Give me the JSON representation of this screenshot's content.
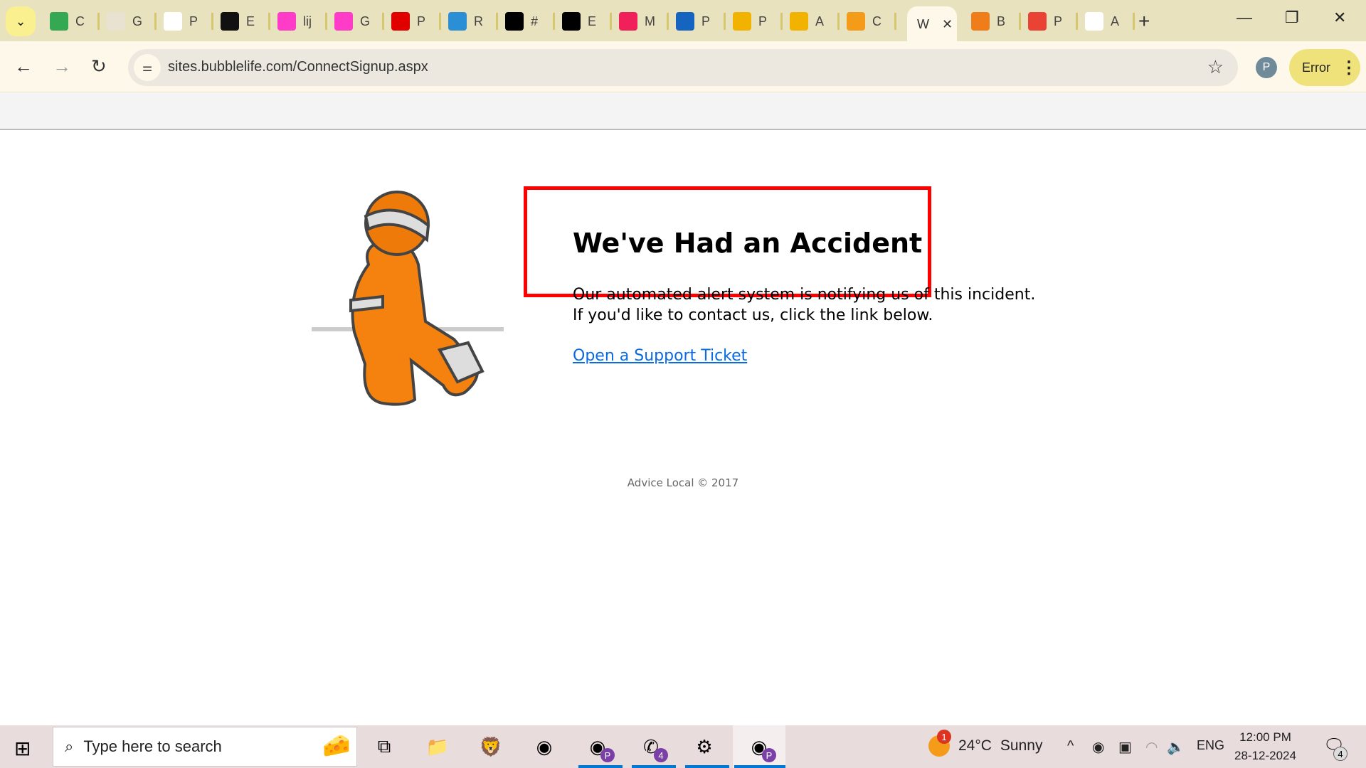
{
  "browser": {
    "tabs": [
      {
        "label": "C",
        "icon": "google-sheets-icon",
        "color": "#34a853"
      },
      {
        "label": "G",
        "icon": "goodreads-icon",
        "color": "#e9e2d0"
      },
      {
        "label": "P",
        "icon": "diamond-logo-icon",
        "color": "#ffffff"
      },
      {
        "label": "E",
        "icon": "document-logo-icon",
        "color": "#111111"
      },
      {
        "label": "lij",
        "icon": "stairs-logo-icon",
        "color": "#ff3cc7"
      },
      {
        "label": "G",
        "icon": "stairs-logo-icon",
        "color": "#ff3cc7"
      },
      {
        "label": "P",
        "icon": "f-logo-icon",
        "color": "#e00000"
      },
      {
        "label": "R",
        "icon": "circle-logo-icon",
        "color": "#2b8fd6"
      },
      {
        "label": "#",
        "icon": "cart-icon",
        "color": "#000000"
      },
      {
        "label": "E",
        "icon": "cart-icon",
        "color": "#000000"
      },
      {
        "label": "M",
        "icon": "link-icon",
        "color": "#f0205a"
      },
      {
        "label": "P",
        "icon": "di-logo-icon",
        "color": "#1565c0"
      },
      {
        "label": "P",
        "icon": "ring-logo-icon",
        "color": "#f2b300"
      },
      {
        "label": "A",
        "icon": "ring-logo-icon",
        "color": "#f2b300"
      },
      {
        "label": "C",
        "icon": "chat-logo-icon",
        "color": "#f59b1a"
      }
    ],
    "active_tab": {
      "label": "W",
      "close": "✕"
    },
    "tabs_after": [
      {
        "label": "B",
        "icon": "bf-logo-icon",
        "color": "#ef7d1a"
      },
      {
        "label": "P",
        "icon": "gmail-icon",
        "color": "#ea4335"
      },
      {
        "label": "A",
        "icon": "house-logo-icon",
        "color": "#ffffff"
      }
    ],
    "new_tab": "+",
    "window": {
      "minimize": "—",
      "restore": "❐",
      "close": "✕"
    },
    "nav": {
      "back": "←",
      "forward": "→",
      "reload": "↻"
    },
    "url": "sites.bubblelife.com/ConnectSignup.aspx",
    "profile_initial": "P",
    "error_label": "Error",
    "menu": "⋮",
    "star": "☆",
    "tab_search": "⌄"
  },
  "page": {
    "title": "We've Had an Accident",
    "message": "Our automated alert system is notifying us of this incident. If you'd like to contact us, click the link below.",
    "link": "Open a Support Ticket",
    "footer": "Advice Local © 2017",
    "annotation_color": "#ff0000",
    "link_color": "#0a6be0"
  },
  "taskbar": {
    "search_placeholder": "Type here to search",
    "apps": [
      {
        "name": "task-view",
        "glyph": "⧉"
      },
      {
        "name": "file-explorer",
        "glyph": "📁"
      },
      {
        "name": "brave",
        "glyph": "🦁"
      },
      {
        "name": "chrome",
        "glyph": "◉"
      },
      {
        "name": "chrome-profile-p",
        "glyph": "◉",
        "badge": "P"
      },
      {
        "name": "whatsapp",
        "glyph": "✆",
        "badge": "4"
      },
      {
        "name": "settings",
        "glyph": "⚙"
      },
      {
        "name": "chrome-active",
        "glyph": "◉",
        "badge": "P"
      }
    ],
    "weather": {
      "temp": "24°C",
      "condition": "Sunny",
      "badge": "1"
    },
    "tray": {
      "chevron": "^",
      "record": "◉",
      "camera": "▣",
      "wifi": "◠",
      "volume": "🔈",
      "language": "ENG"
    },
    "time": "12:00 PM",
    "date": "28-12-2024",
    "notifications": "4"
  }
}
